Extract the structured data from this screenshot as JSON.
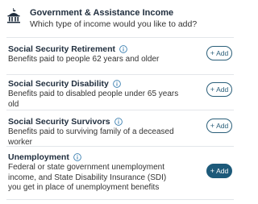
{
  "header": {
    "icon": "government-building-icon",
    "title": "Government & Assistance Income",
    "subtitle": "Which type of income would you like to add?"
  },
  "colors": {
    "accent": "#1d5a7a",
    "info": "#3a7fb0",
    "divider": "#e3e6ea"
  },
  "items": [
    {
      "title": "Social Security Retirement",
      "description": "Benefits paid to people 62 years and older",
      "add_label": "Add",
      "info_icon": "info-icon",
      "active": false
    },
    {
      "title": "Social Security Disability",
      "description": "Benefits paid to disabled people under 65 years old",
      "add_label": "Add",
      "info_icon": "info-icon",
      "active": false
    },
    {
      "title": "Social Security Survivors",
      "description": "Benefits paid to surviving family of a deceased worker",
      "add_label": "Add",
      "info_icon": "info-icon",
      "active": false
    },
    {
      "title": "Unemployment",
      "description": "Federal or state government unemployment income, and State Disability Insurance (SDI) you get in place of unemployment benefits",
      "add_label": "Add",
      "info_icon": "info-icon",
      "active": true
    }
  ]
}
